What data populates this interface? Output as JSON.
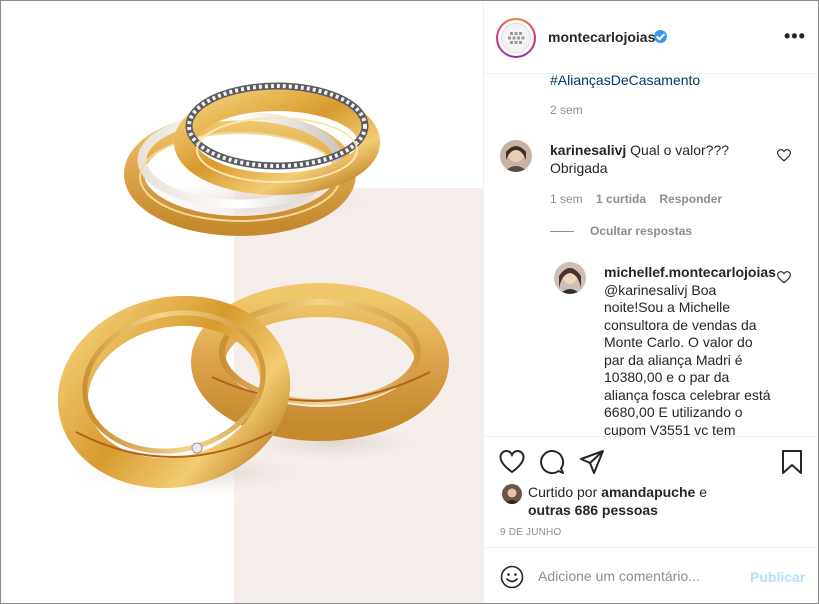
{
  "post": {
    "username": "montecarlojoias",
    "verified": true,
    "more_label": "•••",
    "image_alt": "Alianças de ouro"
  },
  "caption": {
    "hashtag": "#AliançasDeCasamento",
    "time": "2 sem"
  },
  "comments": [
    {
      "username": "karinesalivj",
      "text": "Qual o valor??? Obrigada",
      "time": "1 sem",
      "likes": "1 curtida",
      "reply_label": "Responder"
    }
  ],
  "hide_replies_label": "Ocultar respostas",
  "replies": [
    {
      "username": "michellef.montecarlojoias",
      "text": "@karinesalivj Boa noite!Sou a Michelle consultora de vendas da Monte Carlo. O valor do par da aliança Madri é 10380,00 e o par da aliança fosca celebrar está 6680,00 E utilizando o cupom V3551 vc tem"
    }
  ],
  "likes": {
    "prefix": "Curtido por",
    "user": "amandapuche",
    "connector": "e",
    "others": "outras 686 pessoas"
  },
  "date": "9 DE JUNHO",
  "add_comment": {
    "placeholder": "Adicione um comentário...",
    "publish_label": "Publicar"
  },
  "colors": {
    "link": "#00376b",
    "muted": "#8e8e8e",
    "verified": "#3897f0",
    "publish_disabled": "#b2dffc",
    "gold": "#d9a441"
  }
}
